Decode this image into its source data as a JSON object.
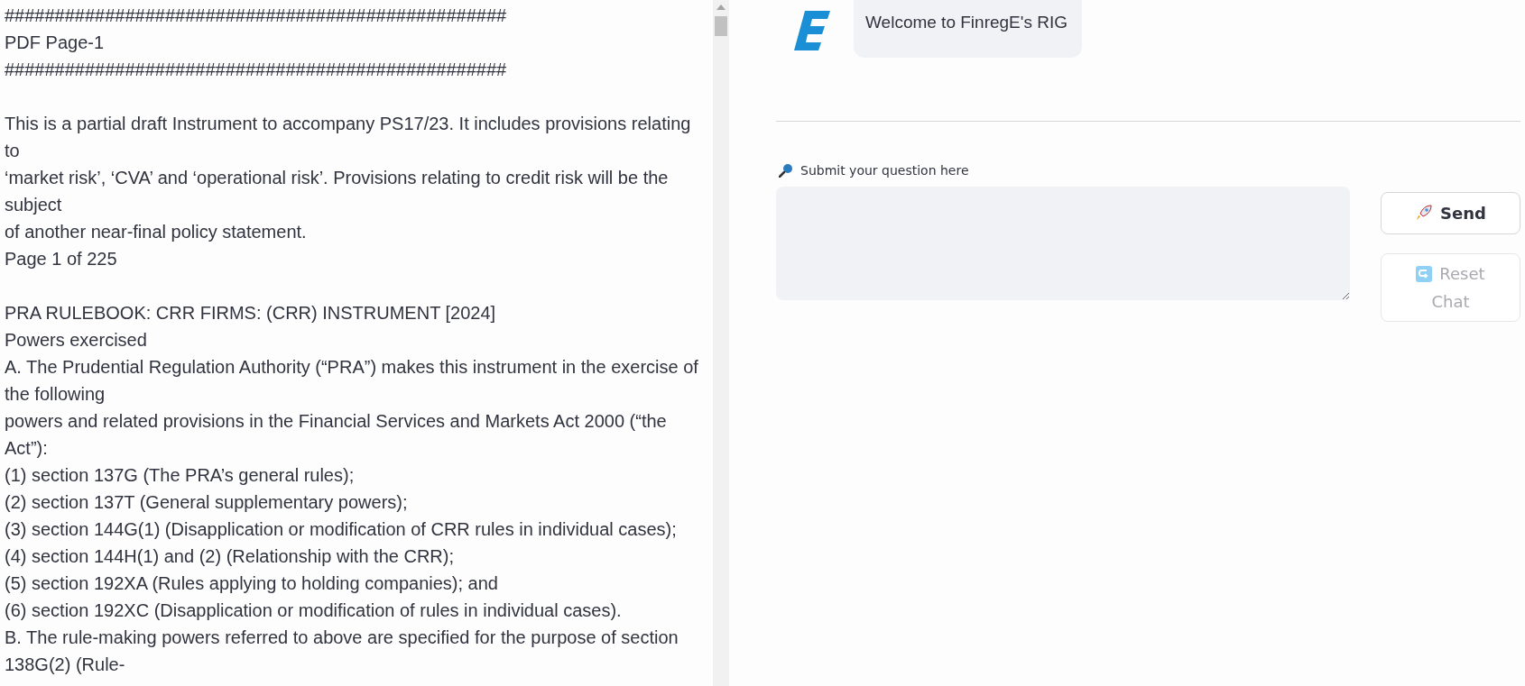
{
  "document": {
    "blocks": [
      [
        "##################################################",
        "PDF Page-1",
        "##################################################"
      ],
      [
        "This is a partial draft Instrument to accompany PS17/23. It includes provisions relating to",
        "‘market risk’, ‘CVA’ and ‘operational risk’. Provisions relating to credit risk will be the subject",
        "of another near-final policy statement.",
        "Page 1 of 225"
      ],
      [
        "PRA RULEBOOK: CRR FIRMS: (CRR) INSTRUMENT [2024]",
        "Powers exercised",
        "A. The Prudential Regulation Authority (“PRA”) makes this instrument in the exercise of the following",
        "powers and related provisions in the Financial Services and Markets Act 2000 (“the Act”):",
        "(1) section 137G (The PRA’s general rules);",
        "(2) section 137T (General supplementary powers);",
        "(3) section 144G(1) (Disapplication or modification of CRR rules in individual cases);",
        "(4) section 144H(1) and (2) (Relationship with the CRR);",
        "(5) section 192XA (Rules applying to holding companies); and",
        "(6) section 192XC (Disapplication or modification of rules in individual cases).",
        "B. The rule-making powers referred to above are specified for the purpose of section 138G(2) (Rule-"
      ]
    ]
  },
  "chat": {
    "messages": [
      {
        "text": "Welcome to FinregE's RIG"
      }
    ]
  },
  "question": {
    "label": "Submit your question here"
  },
  "buttons": [
    {
      "label": "Send",
      "disabled": false
    },
    {
      "label": "Reset Chat",
      "disabled": true
    }
  ]
}
